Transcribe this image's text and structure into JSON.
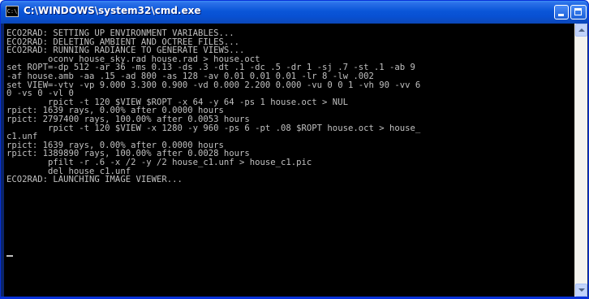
{
  "window": {
    "title": "C:\\WINDOWS\\system32\\cmd.exe",
    "icon_label": "C:\\",
    "colors": {
      "titlebar": "#0a56d8",
      "console_background": "#000000",
      "console_text": "#c0c0c0"
    }
  },
  "titlebar": {
    "icons": {
      "app": "command-prompt-icon",
      "minimize": "minimize-icon",
      "maximize": "maximize-icon"
    }
  },
  "console": {
    "lines": [
      "ECO2RAD: SETTING UP ENVIRONMENT VARIABLES...",
      "ECO2RAD: DELETING AMBIENT AND OCTREE FILES...",
      "ECO2RAD: RUNNING RADIANCE TO GENERATE VIEWS...",
      "        oconv house_sky.rad house.rad > house.oct",
      "set ROPT=-dp 512 -ar 36 -ms 0.13 -ds .3 -dt .1 -dc .5 -dr 1 -sj .7 -st .1 -ab 9",
      "-af house.amb -aa .15 -ad 800 -as 128 -av 0.01 0.01 0.01 -lr 8 -lw .002",
      "set VIEW=-vtv -vp 9.000 3.300 0.900 -vd 0.000 2.200 0.000 -vu 0 0 1 -vh 90 -vv 6",
      "0 -vs 0 -vl 0",
      "        rpict -t 120 $VIEW $ROPT -x 64 -y 64 -ps 1 house.oct > NUL",
      "rpict: 1639 rays, 0.00% after 0.0000 hours",
      "rpict: 2797400 rays, 100.00% after 0.0053 hours",
      "        rpict -t 120 $VIEW -x 1280 -y 960 -ps 6 -pt .08 $ROPT house.oct > house_",
      "c1.unf",
      "rpict: 1639 rays, 0.00% after 0.0000 hours",
      "rpict: 1389890 rays, 100.00% after 0.0028 hours",
      "        pfilt -r .6 -x /2 -y /2 house_c1.unf > house_c1.pic",
      "        del house_c1.unf",
      "ECO2RAD: LAUNCHING IMAGE VIEWER..."
    ]
  },
  "scrollbar": {
    "up_icon": "scroll-up-arrow-icon",
    "down_icon": "scroll-down-arrow-icon"
  }
}
